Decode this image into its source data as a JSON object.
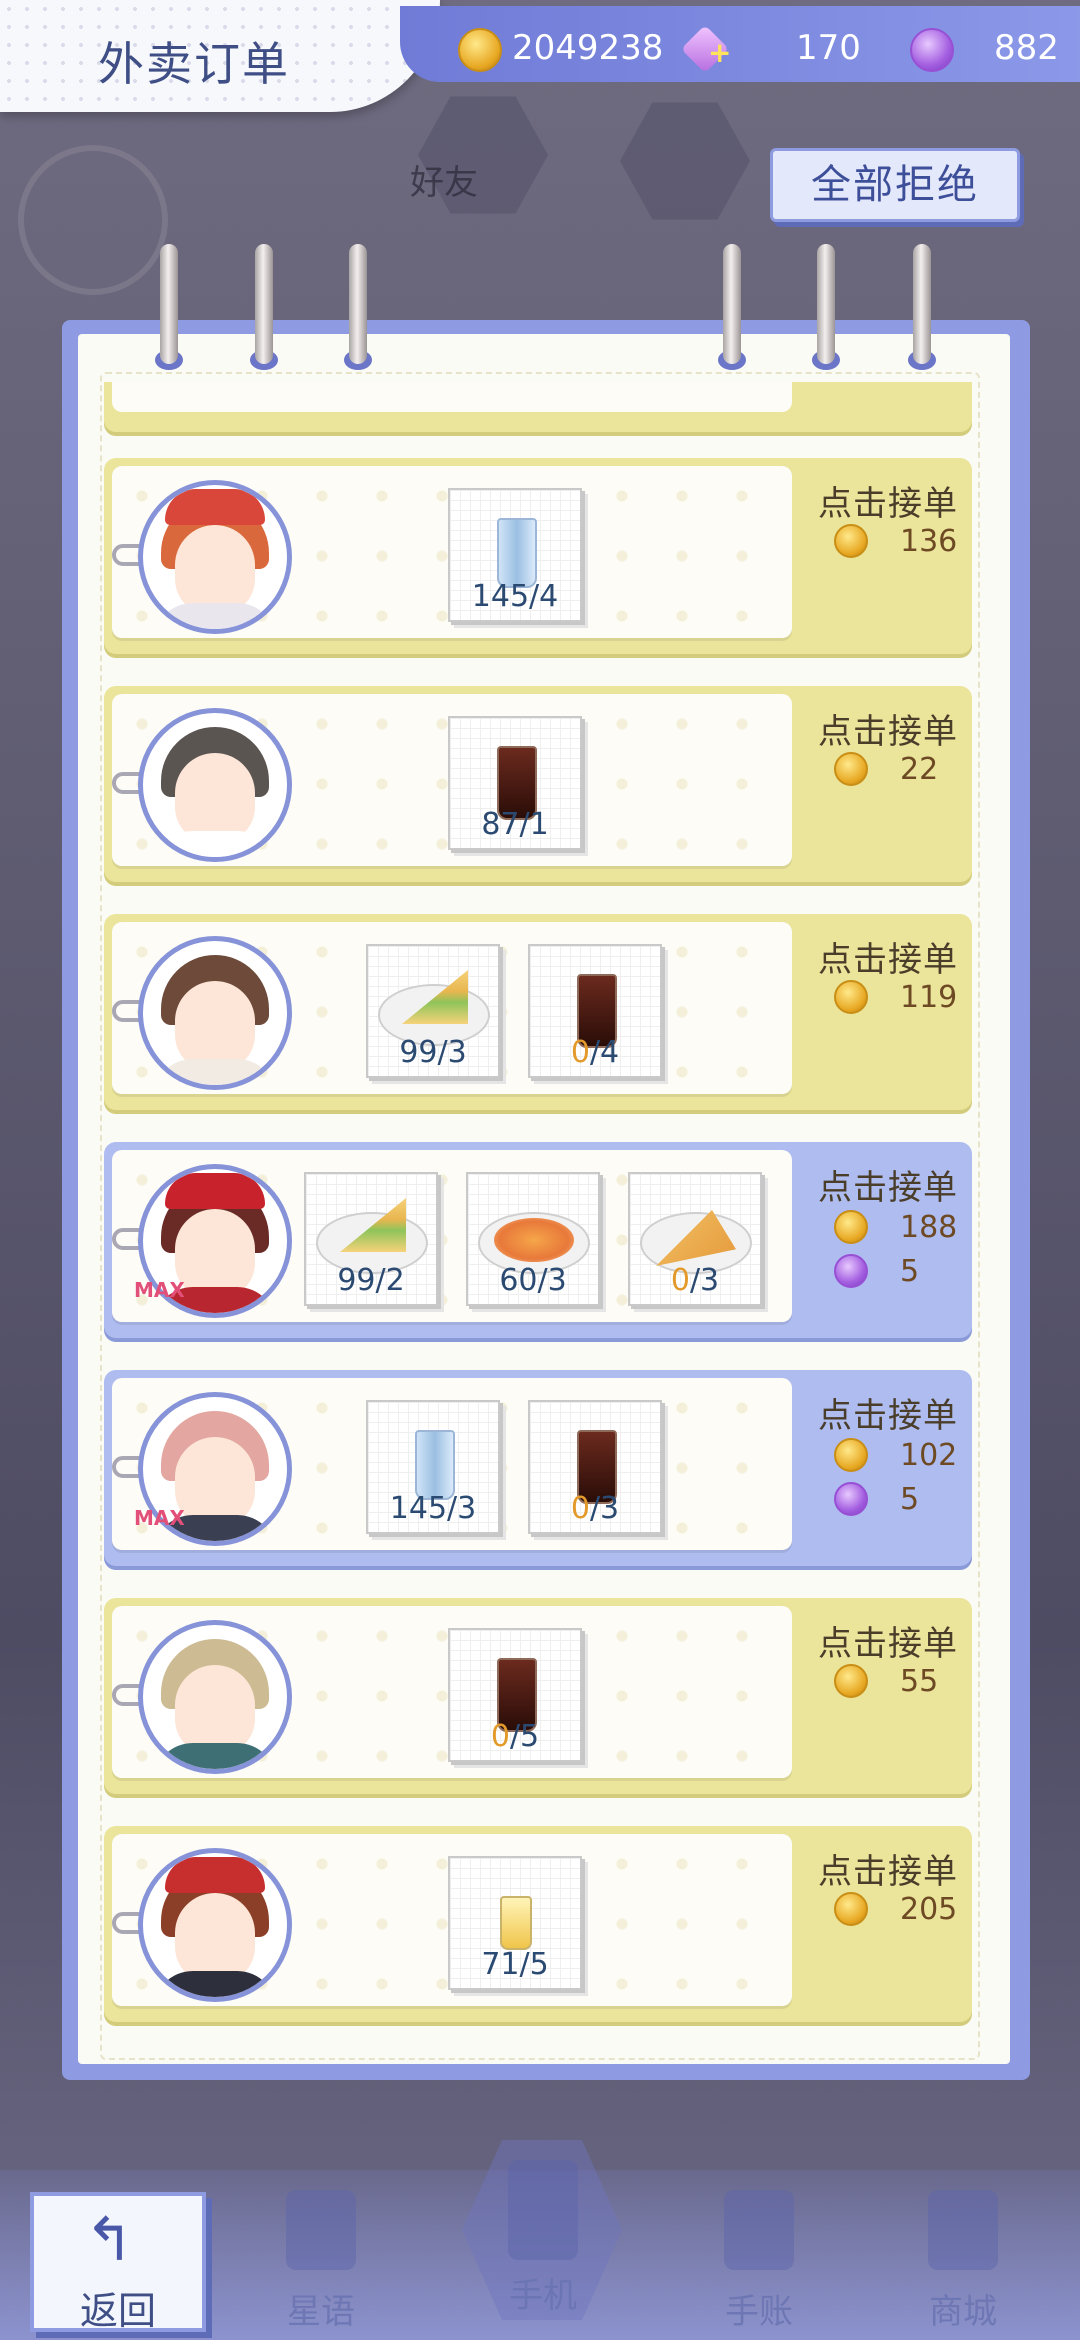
{
  "header": {
    "title": "外卖订单",
    "resources": {
      "coins": "2049238",
      "diamonds": "170",
      "gems": "882"
    }
  },
  "reject_all_label": "全部拒绝",
  "orders": [
    {
      "accept_label": "点击接单",
      "coins": "136",
      "gems": null,
      "max": false,
      "card_color": "yellow",
      "items": [
        {
          "food": "water",
          "count": "145/4",
          "short": false
        }
      ]
    },
    {
      "accept_label": "点击接单",
      "coins": "22",
      "gems": null,
      "max": false,
      "card_color": "yellow",
      "items": [
        {
          "food": "cola",
          "count": "87/1",
          "short": false
        }
      ]
    },
    {
      "accept_label": "点击接单",
      "coins": "119",
      "gems": null,
      "max": false,
      "card_color": "yellow",
      "items": [
        {
          "food": "sandwich",
          "count": "99/3",
          "short": false
        },
        {
          "food": "cola",
          "count": "0/4",
          "short": true
        }
      ]
    },
    {
      "accept_label": "点击接单",
      "coins": "188",
      "gems": "5",
      "max": true,
      "card_color": "blue",
      "items": [
        {
          "food": "sandwich",
          "count": "99/2",
          "short": false
        },
        {
          "food": "pasta",
          "count": "60/3",
          "short": false
        },
        {
          "food": "pizza",
          "count": "0/3",
          "short": true
        }
      ]
    },
    {
      "accept_label": "点击接单",
      "coins": "102",
      "gems": "5",
      "max": true,
      "card_color": "blue",
      "items": [
        {
          "food": "water",
          "count": "145/3",
          "short": false
        },
        {
          "food": "cola",
          "count": "0/3",
          "short": true
        }
      ]
    },
    {
      "accept_label": "点击接单",
      "coins": "55",
      "gems": null,
      "max": false,
      "card_color": "yellow",
      "items": [
        {
          "food": "cola",
          "count": "0/5",
          "short": true
        }
      ]
    },
    {
      "accept_label": "点击接单",
      "coins": "205",
      "gems": null,
      "max": false,
      "card_color": "yellow",
      "items": [
        {
          "food": "juice",
          "count": "71/5",
          "short": false
        }
      ]
    }
  ],
  "max_label": "MAX",
  "background_labels": {
    "friends": "好友"
  },
  "bottom_nav": {
    "back": "返回",
    "items": [
      "星语",
      "手机",
      "手账",
      "商城"
    ]
  },
  "colors": {
    "accent": "#7d8ae0",
    "card_yellow": "#ebe59b",
    "card_blue": "#aebcf0",
    "count_short": "#e39a2a"
  },
  "icons": {
    "coin": "coin-icon",
    "diamond": "diamond-icon",
    "gem": "gem-icon",
    "back": "back-arrow-icon"
  }
}
